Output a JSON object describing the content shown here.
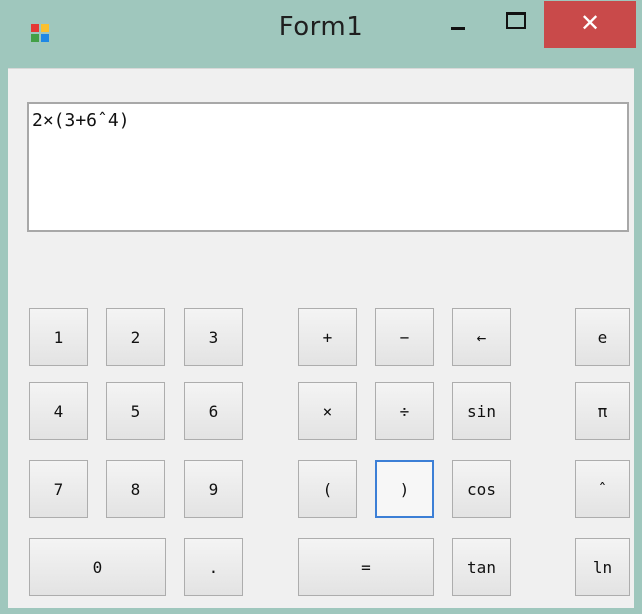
{
  "window": {
    "title": "Form1",
    "close_glyph": "✕"
  },
  "display": {
    "expression": "2×(3+6ˆ4)"
  },
  "keys": {
    "k1": "1",
    "k2": "2",
    "k3": "3",
    "k4": "4",
    "k5": "5",
    "k6": "6",
    "k7": "7",
    "k8": "8",
    "k9": "9",
    "k0": "0",
    "dot": ".",
    "plus": "+",
    "minus": "−",
    "back": "←",
    "times": "×",
    "divide": "÷",
    "lparen": "(",
    "rparen": ")",
    "equals": "=",
    "sin": "sin",
    "cos": "cos",
    "tan": "tan",
    "e": "e",
    "pi": "π",
    "pow": "ˆ",
    "ln": "ln"
  },
  "focused_key": "rparen"
}
